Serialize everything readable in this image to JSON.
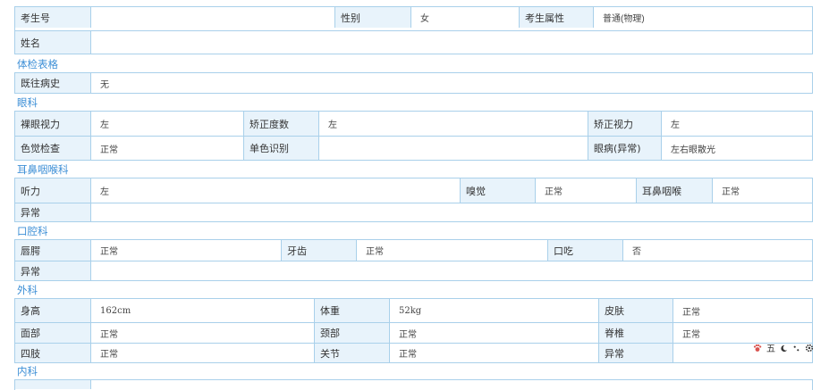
{
  "basic": {
    "exam_no_label": "考生号",
    "exam_no_value": "",
    "gender_label": "性别",
    "gender_value": "女",
    "attr_label": "考生属性",
    "attr_value": "普通(物理)",
    "name_label": "姓名",
    "name_value": ""
  },
  "sections": {
    "physical_form": "体检表格",
    "eye": "眼科",
    "ent": "耳鼻咽喉科",
    "oral": "口腔科",
    "surgery": "外科",
    "internal": "内科"
  },
  "history": {
    "label": "既往病史",
    "value": "无"
  },
  "eye": {
    "naked_label": "裸眼视力",
    "naked_value": "左",
    "degree_label": "矫正度数",
    "degree_value": "左",
    "corrected_label": "矫正视力",
    "corrected_value": "左",
    "color_label": "色觉检查",
    "color_value": "正常",
    "mono_label": "单色识别",
    "mono_value": "",
    "disease_label": "眼病(异常)",
    "disease_value": "左右眼散光"
  },
  "ent": {
    "hearing_label": "听力",
    "hearing_value": "左",
    "smell_label": "嗅觉",
    "smell_value": "正常",
    "ent_label": "耳鼻咽喉",
    "ent_value": "正常",
    "abnormal_label": "异常",
    "abnormal_value": ""
  },
  "oral": {
    "lip_label": "唇腭",
    "lip_value": "正常",
    "teeth_label": "牙齿",
    "teeth_value": "正常",
    "stutter_label": "口吃",
    "stutter_value": "否",
    "abnormal_label": "异常",
    "abnormal_value": ""
  },
  "surgery": {
    "height_label": "身高",
    "height_value": "162cm",
    "weight_label": "体重",
    "weight_value": "52kg",
    "skin_label": "皮肤",
    "skin_value": "正常",
    "face_label": "面部",
    "face_value": "正常",
    "neck_label": "颈部",
    "neck_value": "正常",
    "spine_label": "脊椎",
    "spine_value": "正常",
    "limbs_label": "四肢",
    "limbs_value": "正常",
    "joint_label": "关节",
    "joint_value": "正常",
    "abnormal_label": "异常",
    "abnormal_value": ""
  },
  "toolbar": {
    "items": [
      "五",
      "⟩",
      "°,"
    ],
    "icons": [
      "paw-icon",
      "moon-icon",
      "dots-icon",
      "gear-icon"
    ]
  }
}
